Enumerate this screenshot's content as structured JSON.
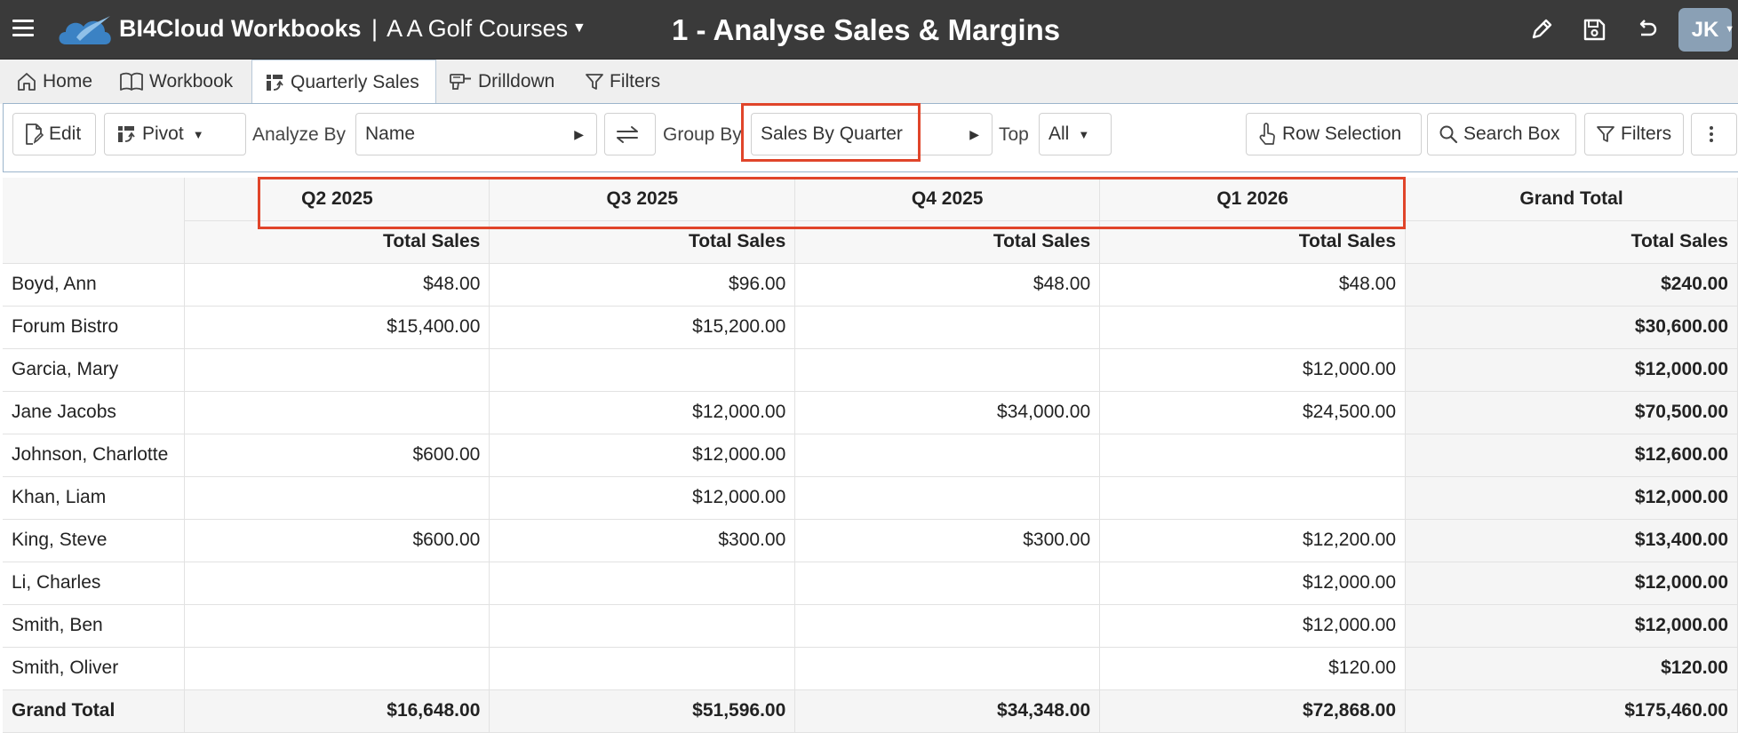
{
  "app": {
    "brand": "BI4Cloud Workbooks",
    "separator": "|",
    "workbook_name": "A A Golf Courses",
    "page_title": "1 - Analyse Sales & Margins",
    "user_initials": "JK"
  },
  "tabs": [
    {
      "label": "Home",
      "icon": "home-icon"
    },
    {
      "label": "Workbook",
      "icon": "book-icon"
    },
    {
      "label": "Quarterly Sales",
      "icon": "pivot-icon",
      "active": true
    },
    {
      "label": "Drilldown",
      "icon": "drill-icon"
    },
    {
      "label": "Filters",
      "icon": "filter-icon"
    }
  ],
  "toolbar": {
    "edit_label": "Edit",
    "pivot_label": "Pivot",
    "analyze_by_label": "Analyze By",
    "analyze_by_value": "Name",
    "group_by_label": "Group By",
    "group_by_value": "Sales By Quarter",
    "top_label": "Top",
    "top_value": "All",
    "row_selection_label": "Row Selection",
    "search_box_label": "Search Box",
    "filters_label": "Filters"
  },
  "table": {
    "quarters": [
      "Q2 2025",
      "Q3 2025",
      "Q4 2025",
      "Q1 2026"
    ],
    "grand_total_header": "Grand Total",
    "measure_label": "Total Sales",
    "rows": [
      {
        "name": "Boyd, Ann",
        "cells": [
          "$48.00",
          "$96.00",
          "$48.00",
          "$48.00"
        ],
        "total": "$240.00"
      },
      {
        "name": "Forum Bistro",
        "cells": [
          "$15,400.00",
          "$15,200.00",
          "",
          ""
        ],
        "total": "$30,600.00"
      },
      {
        "name": "Garcia, Mary",
        "cells": [
          "",
          "",
          "",
          "$12,000.00"
        ],
        "total": "$12,000.00"
      },
      {
        "name": "Jane Jacobs",
        "cells": [
          "",
          "$12,000.00",
          "$34,000.00",
          "$24,500.00"
        ],
        "total": "$70,500.00"
      },
      {
        "name": "Johnson, Charlotte",
        "cells": [
          "$600.00",
          "$12,000.00",
          "",
          ""
        ],
        "total": "$12,600.00"
      },
      {
        "name": "Khan, Liam",
        "cells": [
          "",
          "$12,000.00",
          "",
          ""
        ],
        "total": "$12,000.00"
      },
      {
        "name": "King, Steve",
        "cells": [
          "$600.00",
          "$300.00",
          "$300.00",
          "$12,200.00"
        ],
        "total": "$13,400.00"
      },
      {
        "name": "Li, Charles",
        "cells": [
          "",
          "",
          "",
          "$12,000.00"
        ],
        "total": "$12,000.00"
      },
      {
        "name": "Smith, Ben",
        "cells": [
          "",
          "",
          "",
          "$12,000.00"
        ],
        "total": "$12,000.00"
      },
      {
        "name": "Smith, Oliver",
        "cells": [
          "",
          "",
          "",
          "$120.00"
        ],
        "total": "$120.00"
      }
    ],
    "grand_total_row": {
      "name": "Grand Total",
      "cells": [
        "$16,648.00",
        "$51,596.00",
        "$34,348.00",
        "$72,868.00"
      ],
      "total": "$175,460.00"
    }
  },
  "colors": {
    "topbar": "#3a3a3a",
    "highlight": "#e0452a",
    "avatar": "#8aa0b5"
  }
}
